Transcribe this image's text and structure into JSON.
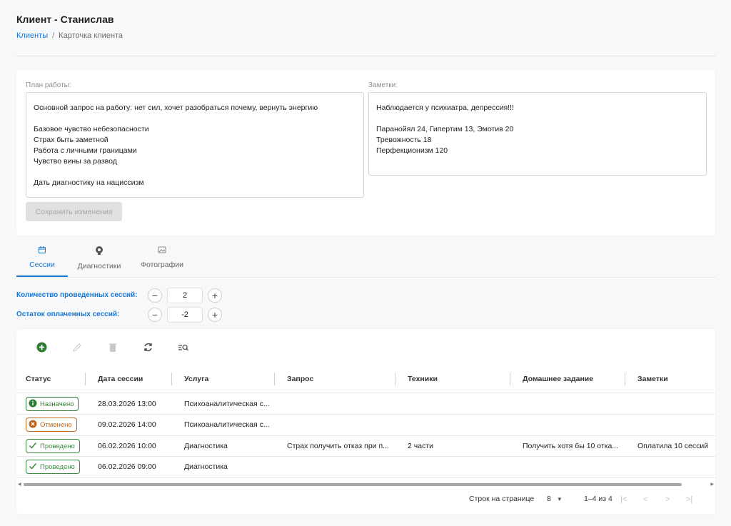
{
  "header": {
    "title": "Клиент - Станислав",
    "breadcrumb": {
      "link": "Клиенты",
      "separator": "/",
      "current": "Карточка клиента"
    }
  },
  "plan": {
    "label": "План работы:",
    "text": "Основной запрос на работу: нет сил, хочет разобраться почему, вернуть энергию\n\nБазовое чувство небезопасности\nСтрах быть заметной\nРабота с личными границами\nЧувство вины за развод\n\nДать диагностику на нацисcизм"
  },
  "notes": {
    "label": "Заметки:",
    "text": "Наблюдается у психиатра, депрессия!!!\n\nПаранойял 24, Гипертим 13, Эмотив 20\nТревожность 18\nПерфекционизм 120"
  },
  "save_button": "Сохранить изменения",
  "tabs": [
    {
      "label": "Сессии",
      "icon": "calendar-icon",
      "active": true
    },
    {
      "label": "Диагностики",
      "icon": "brain-icon",
      "active": false
    },
    {
      "label": "Фотографии",
      "icon": "image-icon",
      "active": false
    }
  ],
  "counters": {
    "sessions_done": {
      "label": "Количество проведенных сессий:",
      "value": "2"
    },
    "sessions_left": {
      "label": "Остаток оплаченных сессий:",
      "value": "-2"
    }
  },
  "toolbar": {
    "icons": [
      "add-icon",
      "edit-icon",
      "delete-icon",
      "refresh-icon",
      "filter-search-icon"
    ]
  },
  "table": {
    "columns": [
      "Статус",
      "Дата сессии",
      "Услуга",
      "Запрос",
      "Техники",
      "Домашнее задание",
      "Заметки"
    ],
    "rows": [
      {
        "status": "Назначено",
        "status_type": "scheduled",
        "date": "28.03.2026 13:00",
        "service": "Психоаналитическая с...",
        "request": "",
        "techniques": "",
        "homework": "",
        "notes": ""
      },
      {
        "status": "Отменено",
        "status_type": "cancelled",
        "date": "09.02.2026 14:00",
        "service": "Психоаналитическая с...",
        "request": "",
        "techniques": "",
        "homework": "",
        "notes": ""
      },
      {
        "status": "Проведено",
        "status_type": "done",
        "date": "06.02.2026 10:00",
        "service": "Диагностика",
        "request": "Страх получить отказ при п...",
        "techniques": "2 части",
        "homework": "Получить хотя бы 10 отка...",
        "notes": "Оплатила 10 сессий"
      },
      {
        "status": "Проведено",
        "status_type": "done",
        "date": "06.02.2026 09:00",
        "service": "Диагностика",
        "request": "",
        "techniques": "",
        "homework": "",
        "notes": ""
      }
    ]
  },
  "pagination": {
    "rows_per_page_label": "Строк на странице",
    "rows_per_page": "8",
    "range": "1–4 из 4"
  },
  "colors": {
    "accent": "#1976d2",
    "scheduled": "#2e7d32",
    "cancelled": "#c0671a",
    "done": "#388e3c",
    "add_button": "#2e7d32"
  }
}
